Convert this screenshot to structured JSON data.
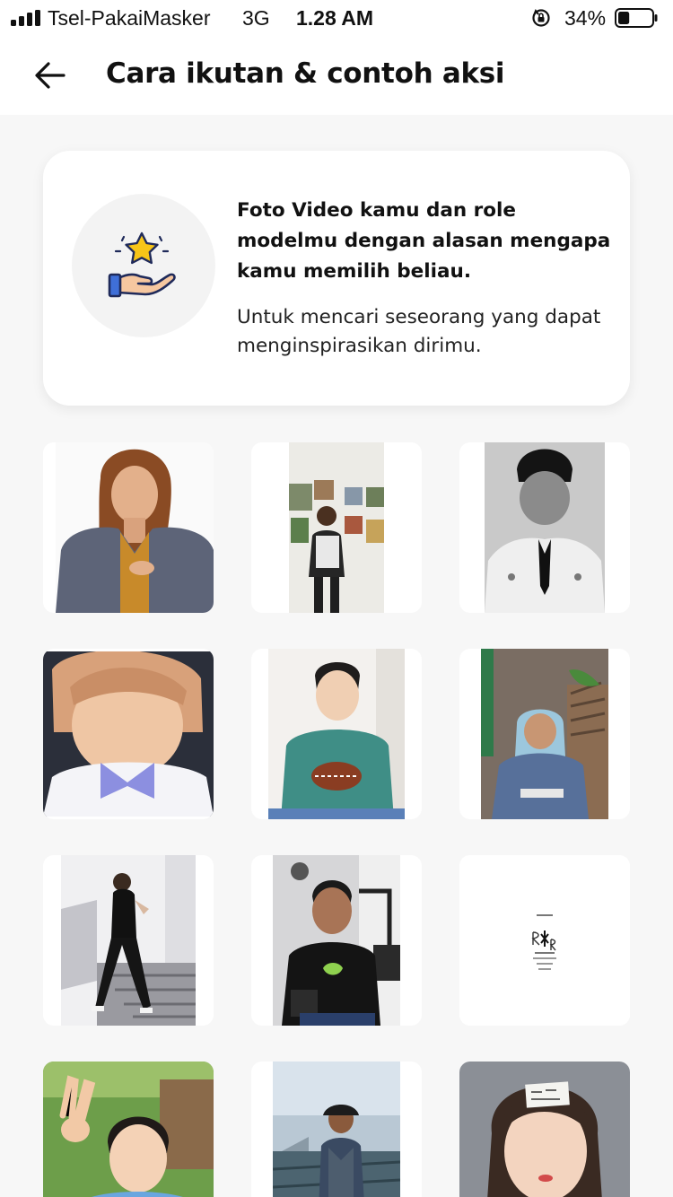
{
  "status_bar": {
    "carrier": "Tsel-PakaiMasker",
    "network": "3G",
    "time": "1.28 AM",
    "battery_percent": "34%",
    "battery_level": 0.34,
    "signal_bars": 4
  },
  "header": {
    "back_icon": "arrow-left-icon",
    "title": "Cara ikutan & contoh aksi"
  },
  "info_card": {
    "icon": "star-in-hand-icon",
    "title": "Foto  Video kamu dan role modelmu dengan alasan mengapa kamu memilih beliau.",
    "description": "Untuk mencari seseorang yang dapat menginspirasikan dirimu."
  },
  "examples": {
    "doc_tile_text": "R  R"
  },
  "colors": {
    "background": "#f7f7f7",
    "card": "#ffffff",
    "icon_star": "#f7c518",
    "icon_hand_outline": "#1f2a5a",
    "icon_hand_fill": "#f6c7a0",
    "icon_cuff": "#3f6fd8"
  }
}
